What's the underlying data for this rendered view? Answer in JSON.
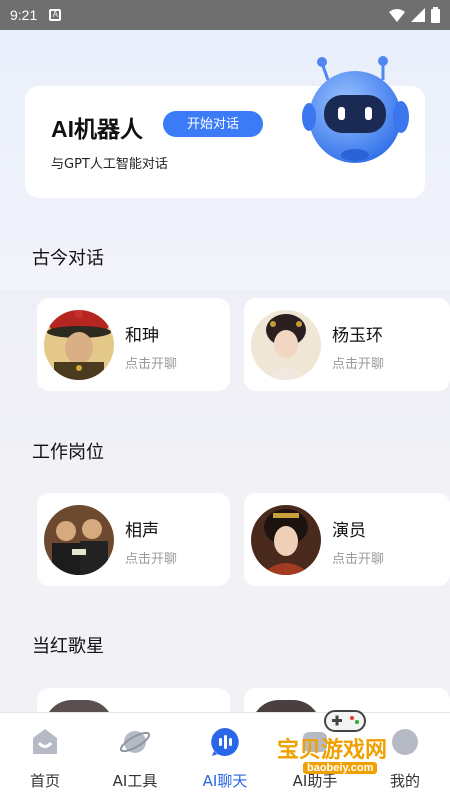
{
  "status": {
    "time": "9:21"
  },
  "hero": {
    "title": "AI机器人",
    "button": "开始对话",
    "subtitle": "与GPT人工智能对话"
  },
  "sections": [
    {
      "title": "古今对话",
      "cards": [
        {
          "name": "和珅",
          "hint": "点击开聊"
        },
        {
          "name": "杨玉环",
          "hint": "点击开聊"
        }
      ]
    },
    {
      "title": "工作岗位",
      "cards": [
        {
          "name": "相声",
          "hint": "点击开聊"
        },
        {
          "name": "演员",
          "hint": "点击开聊"
        }
      ]
    },
    {
      "title": "当红歌星",
      "cards": []
    }
  ],
  "tabs": [
    {
      "label": "首页",
      "icon": "home-icon"
    },
    {
      "label": "AI工具",
      "icon": "planet-icon"
    },
    {
      "label": "AI聊天",
      "icon": "voice-chat-icon"
    },
    {
      "label": "AI助手",
      "icon": "assistant-icon"
    },
    {
      "label": "我的",
      "icon": "profile-icon"
    }
  ],
  "watermark": {
    "text": "宝贝游戏网",
    "url": "baobeiy.com"
  },
  "colors": {
    "accent": "#3b7cf6",
    "active_tab": "#2a66e8",
    "hint": "#9a9a9a"
  }
}
